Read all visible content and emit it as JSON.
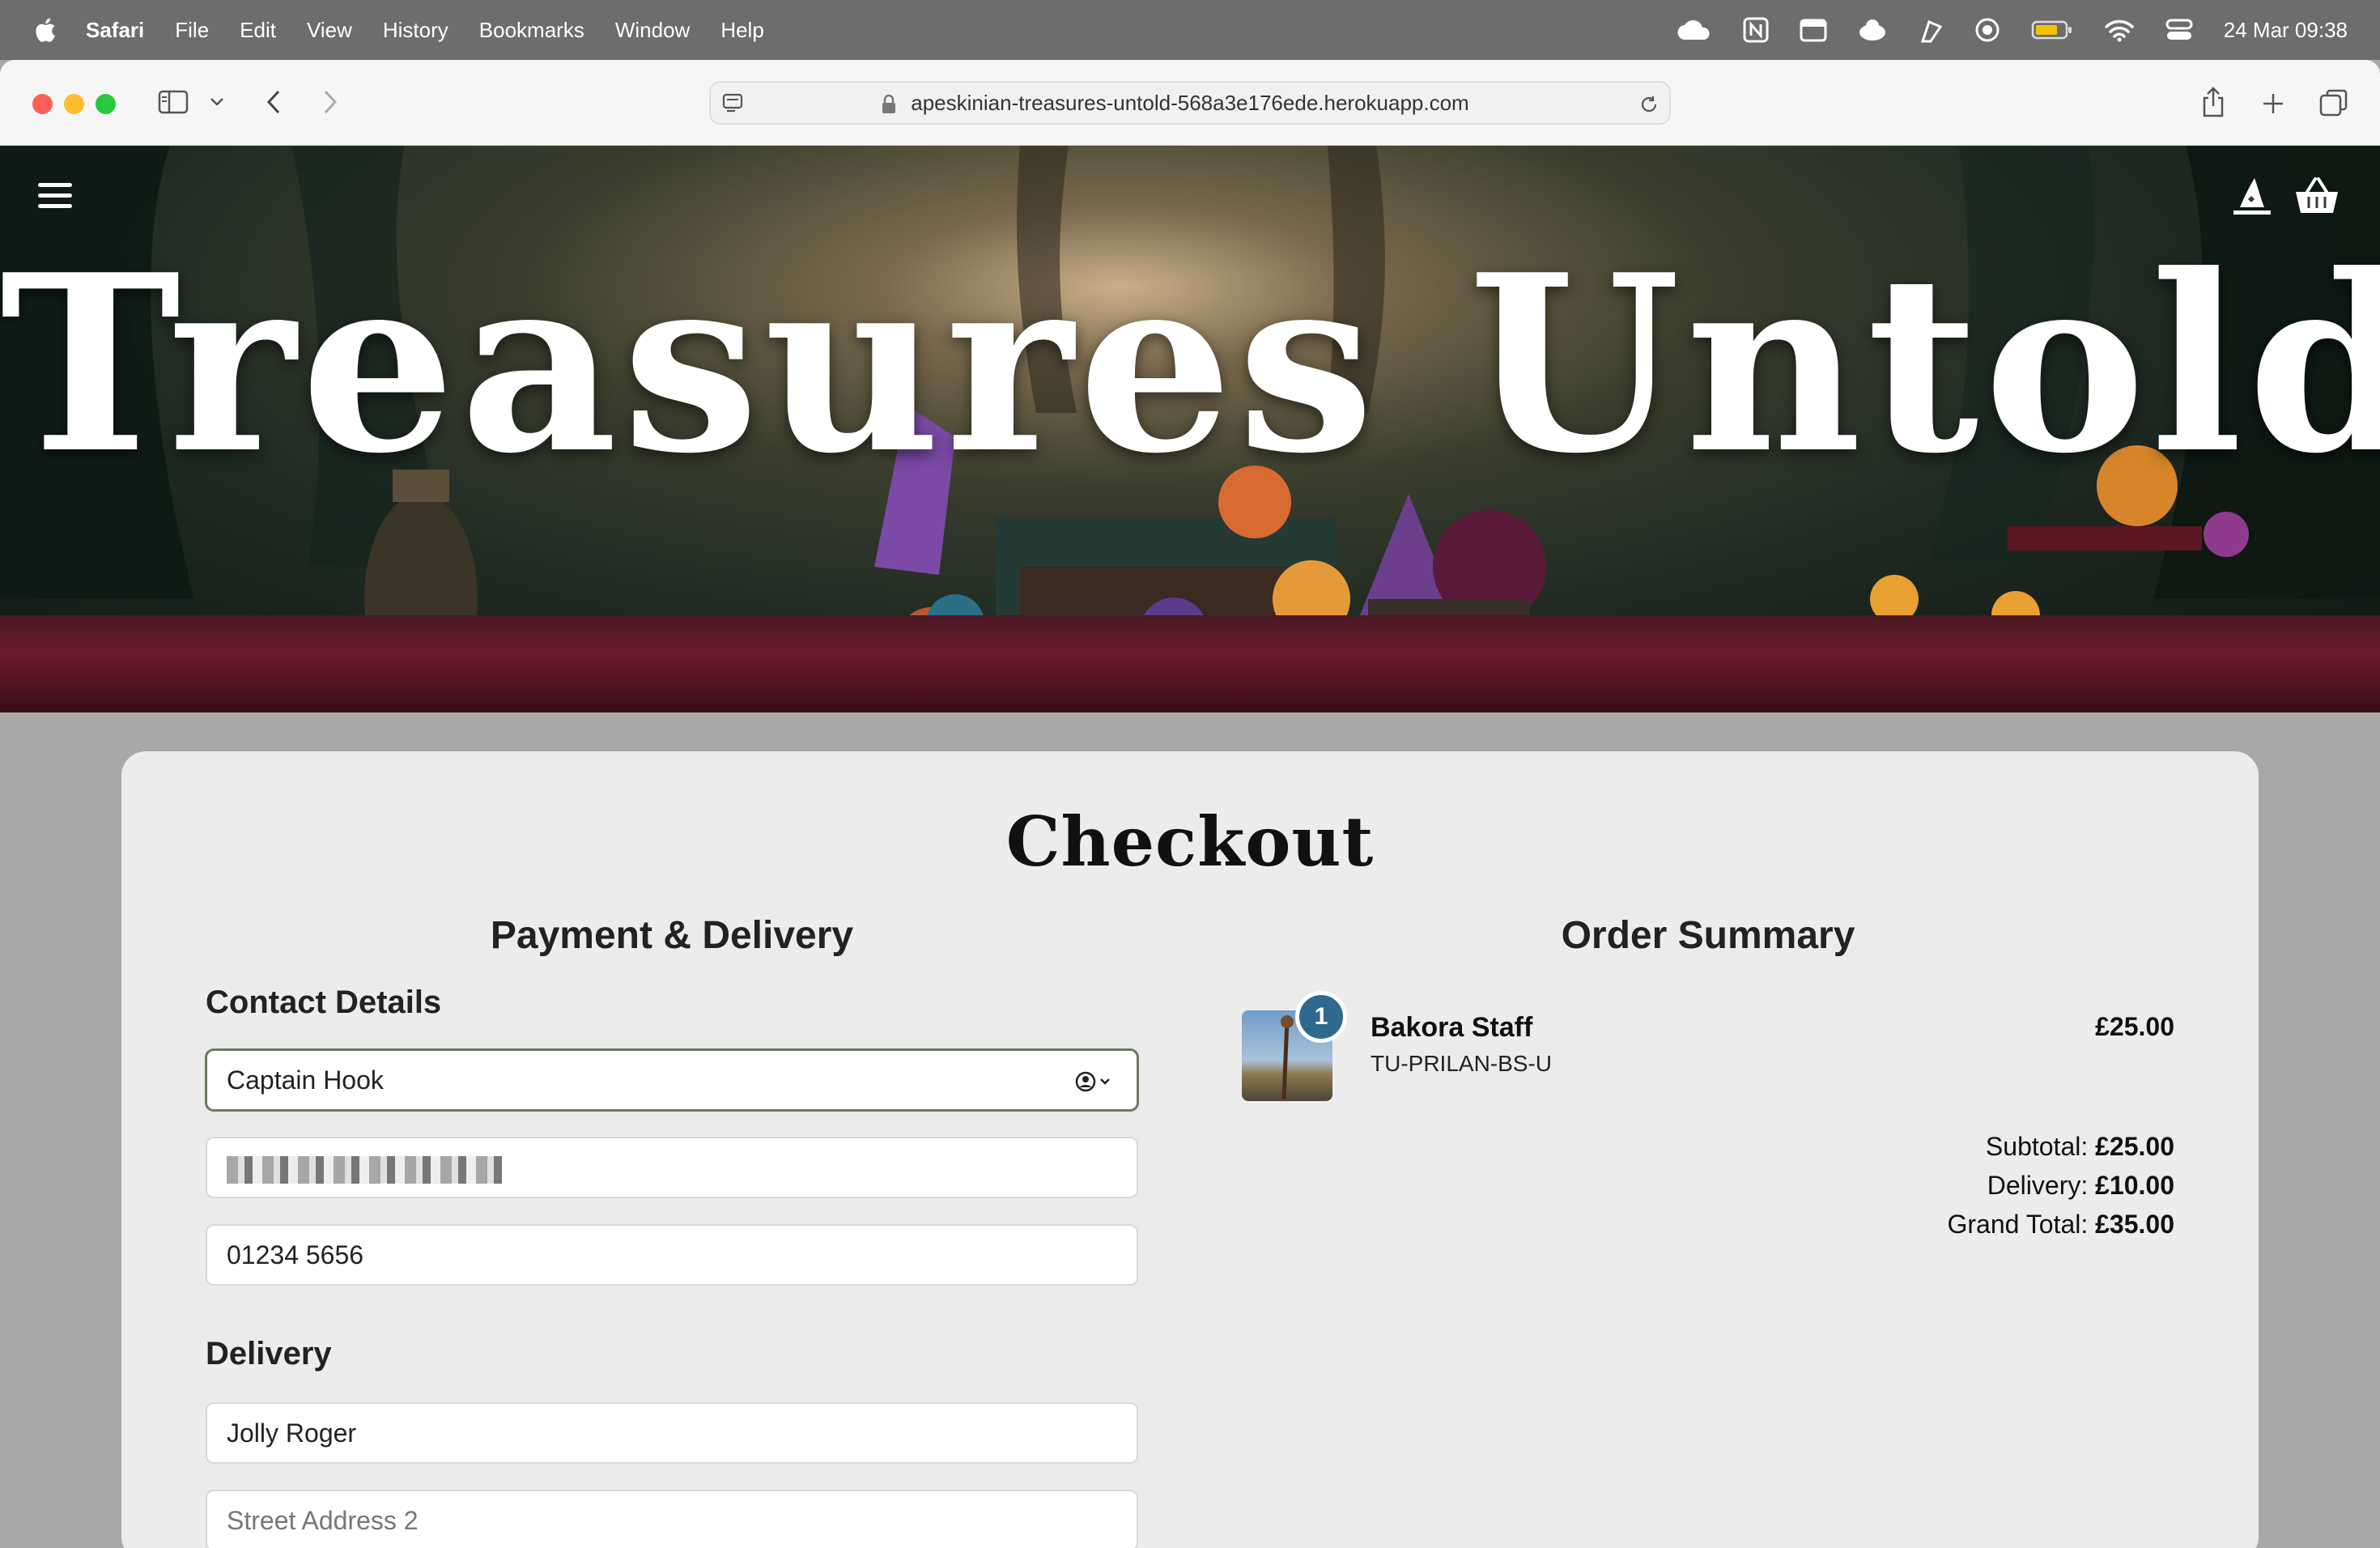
{
  "menubar": {
    "app_name": "Safari",
    "items": [
      "File",
      "Edit",
      "View",
      "History",
      "Bookmarks",
      "Window",
      "Help"
    ],
    "clock": "24 Mar  09:38"
  },
  "browser": {
    "url": "apeskinian-treasures-untold-568a3e176ede.herokuapp.com"
  },
  "hero": {
    "title": "Treasures Untold"
  },
  "checkout": {
    "title": "Checkout",
    "left": {
      "title": "Payment & Delivery",
      "contact_title": "Contact Details",
      "full_name": "Captain Hook",
      "phone": "01234 5656",
      "delivery_title": "Delivery",
      "street1": "Jolly Roger",
      "street2_placeholder": "Street Address 2"
    },
    "right": {
      "title": "Order Summary",
      "item": {
        "quantity": "1",
        "name": "Bakora Staff",
        "sku": "TU-PRILAN-BS-U",
        "price": "£25.00"
      },
      "subtotal_label": "Subtotal:",
      "subtotal": "£25.00",
      "delivery_label": "Delivery:",
      "delivery": "£10.00",
      "grand_total_label": "Grand Total:",
      "grand_total": "£35.00"
    }
  }
}
